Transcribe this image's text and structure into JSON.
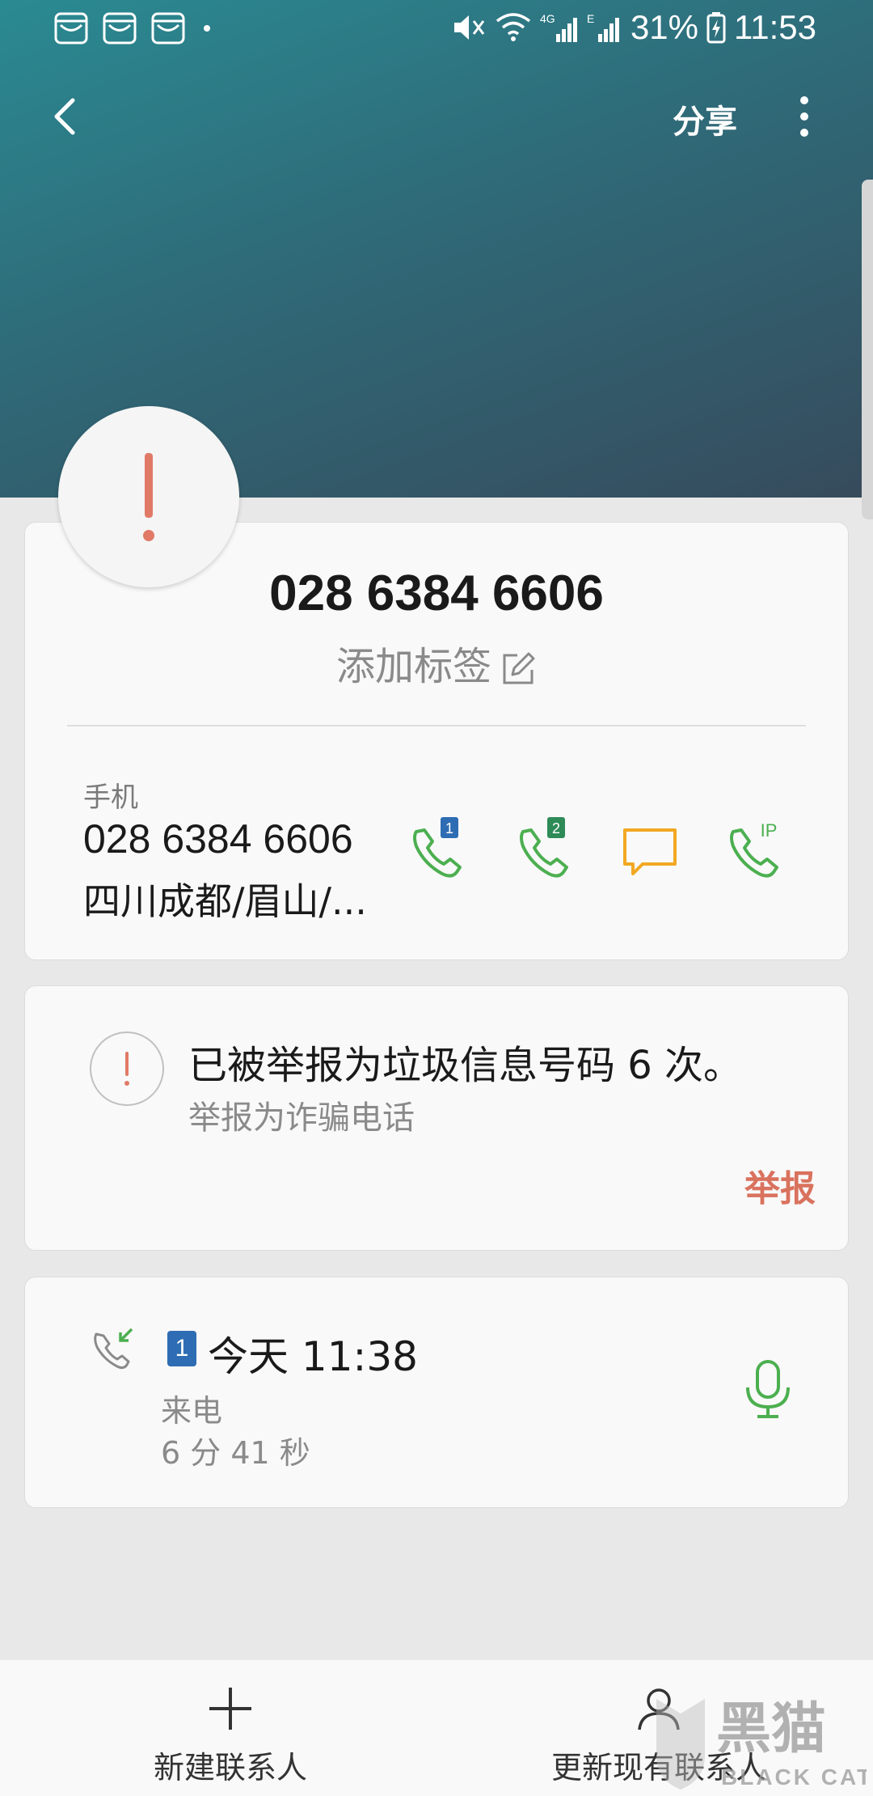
{
  "status_bar": {
    "battery": "31%",
    "time": "11:53",
    "network_4g": "4G",
    "network_e": "E",
    "icons": [
      "notification-app-icon",
      "notification-app-icon",
      "notification-app-icon",
      "mute-icon",
      "wifi-icon",
      "signal-icon",
      "signal-icon",
      "battery-charging-icon"
    ]
  },
  "top_bar": {
    "share_label": "分享"
  },
  "contact": {
    "number": "028 6384 6606",
    "add_tag_label": "添加标签"
  },
  "phone_entry": {
    "label": "手机",
    "number": "028 6384 6606",
    "location": "四川成都/眉山/...",
    "sim1_badge": "1",
    "sim2_badge": "2",
    "ip_label": "IP"
  },
  "spam": {
    "title": "已被举报为垃圾信息号码 6 次。",
    "subtitle": "举报为诈骗电话",
    "report_label": "举报"
  },
  "call_log": {
    "sim_badge": "1",
    "time": "今天 11:38",
    "type": "来电",
    "duration": "6 分 41 秒"
  },
  "bottom_bar": {
    "new_contact_label": "新建联系人",
    "update_contact_label": "更新现有联系人"
  },
  "watermark": {
    "text_cn": "黑猫",
    "text_en": "BLACK CAT"
  },
  "colors": {
    "accent_green": "#4caf50",
    "warning_red": "#e07a66",
    "message_orange": "#f2a823",
    "sim_blue": "#2e6db3",
    "sim_green": "#2e8b57"
  }
}
